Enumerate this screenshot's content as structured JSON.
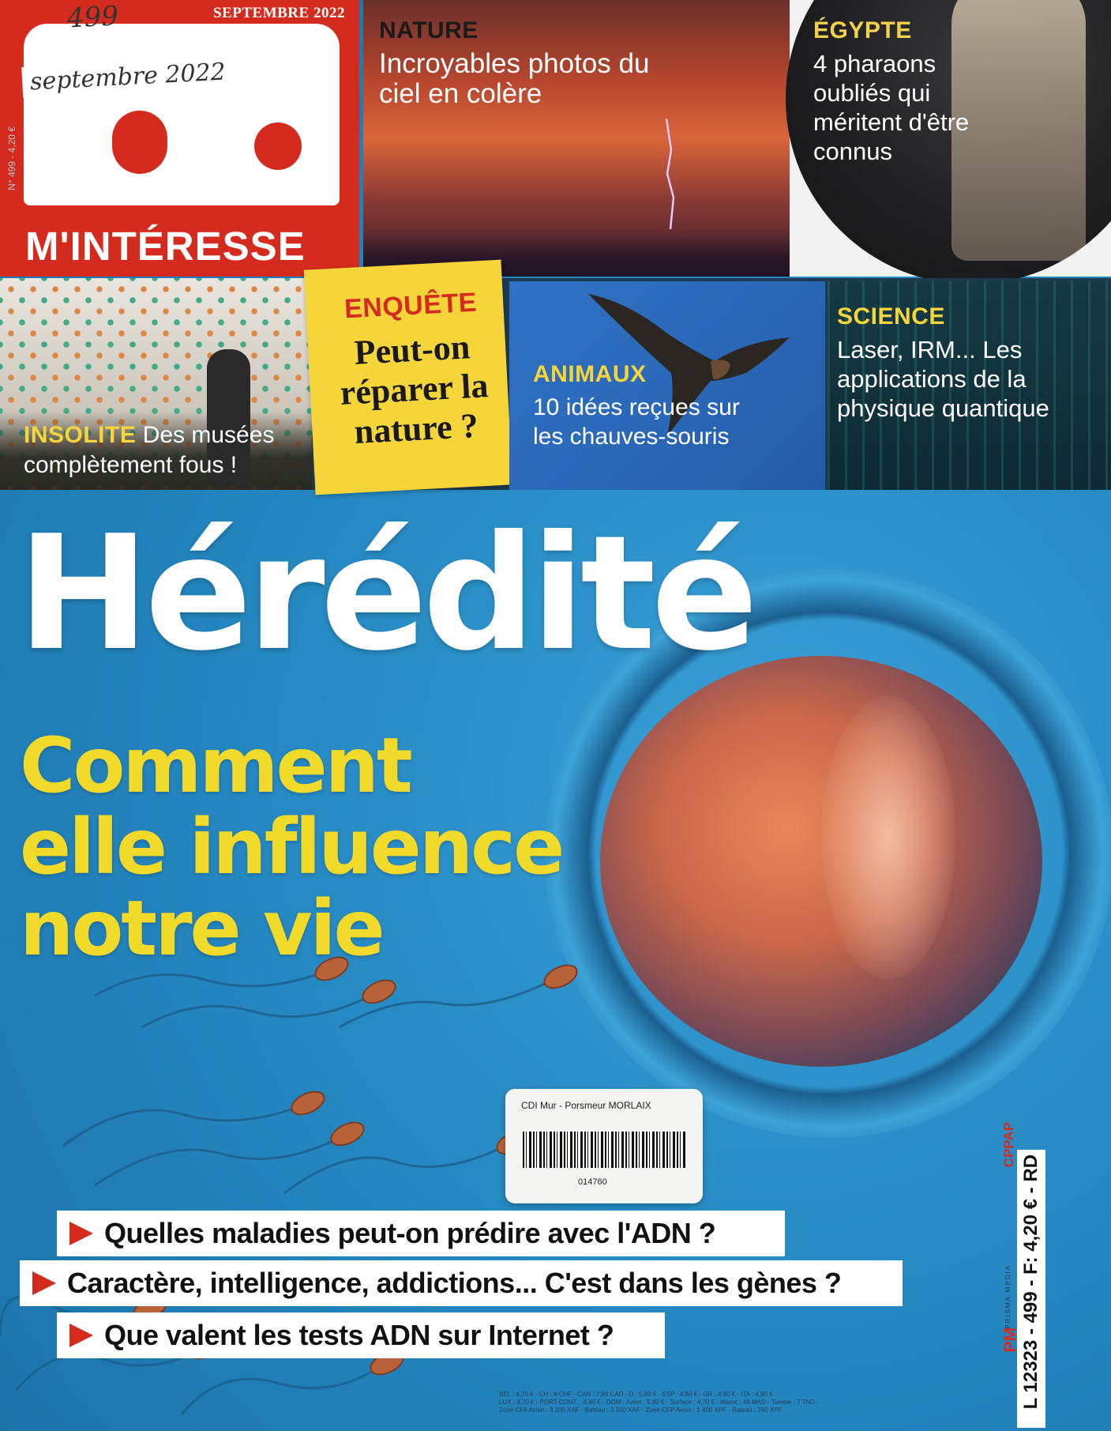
{
  "magazine": {
    "logo_top": "Ça",
    "logo_bottom": "M'INTÉRESSE",
    "issue_date": "SEPTEMBRE 2022",
    "handwritten_number": "499",
    "handwritten_date": "septembre 2022",
    "spine_text": "N° 499 - 4,20 €"
  },
  "teasers": {
    "nature": {
      "kicker": "NATURE",
      "title": "Incroyables photos du ciel en colère"
    },
    "egypte": {
      "kicker": "ÉGYPTE",
      "title": "4 pharaons oubliés qui méritent d'être connus"
    },
    "insolite": {
      "kicker": "INSOLITE",
      "title": "Des musées complètement fous !"
    },
    "enquete": {
      "kicker": "ENQUÊTE",
      "title": "Peut-on réparer la nature ?"
    },
    "animaux": {
      "kicker": "ANIMAUX",
      "title": "10 idées reçues sur les chauves-souris"
    },
    "science": {
      "kicker": "SCIENCE",
      "title": "Laser, IRM... Les applications de la physique quantique"
    }
  },
  "cover_story": {
    "headline": "Hérédité",
    "subhead_lines": [
      "Comment",
      "elle influence",
      "notre vie"
    ],
    "bullets": [
      "Quelles maladies peut-on prédire avec l'ADN ?",
      "Caractère, intelligence, addictions... C'est dans les gènes ?",
      "Que valent les tests ADN sur Internet ?"
    ]
  },
  "library_label": {
    "owner": "CDI Mur - Porsmeur MORLAIX",
    "number": "014760"
  },
  "footer": {
    "price_line_1": "BEL : 4,70 € - CH : 8 CHF - CAN : 7,99 CAD - D : 5,80 € - ESP : 4,80 € - GR : 4,80 € - ITA : 4,80 € -",
    "price_line_2": "LUX : 4,70 € - PORT CONT. : 4,80 € - DOM : Avion : 5,80 € - Surface : 4,70 € - Maroc : 48 MAD - Tunisie : 7 TND -",
    "price_line_3": "Zone CFA Avion : 3 200 XAF - Bateau : 3 500 XAF - Zone CFP Avion : 1 400 XPF - Bateau : 760 XPF",
    "cppap": "CPPAP",
    "publisher": "PM",
    "publisher_small": "PRISMA MEDIA",
    "barcode_text": "L 12323 - 499 - F: 4,20 € - RD"
  },
  "colors": {
    "brand_red": "#d52b1e",
    "accent_yellow": "#f2da2b",
    "background_blue": "#2689c2"
  }
}
